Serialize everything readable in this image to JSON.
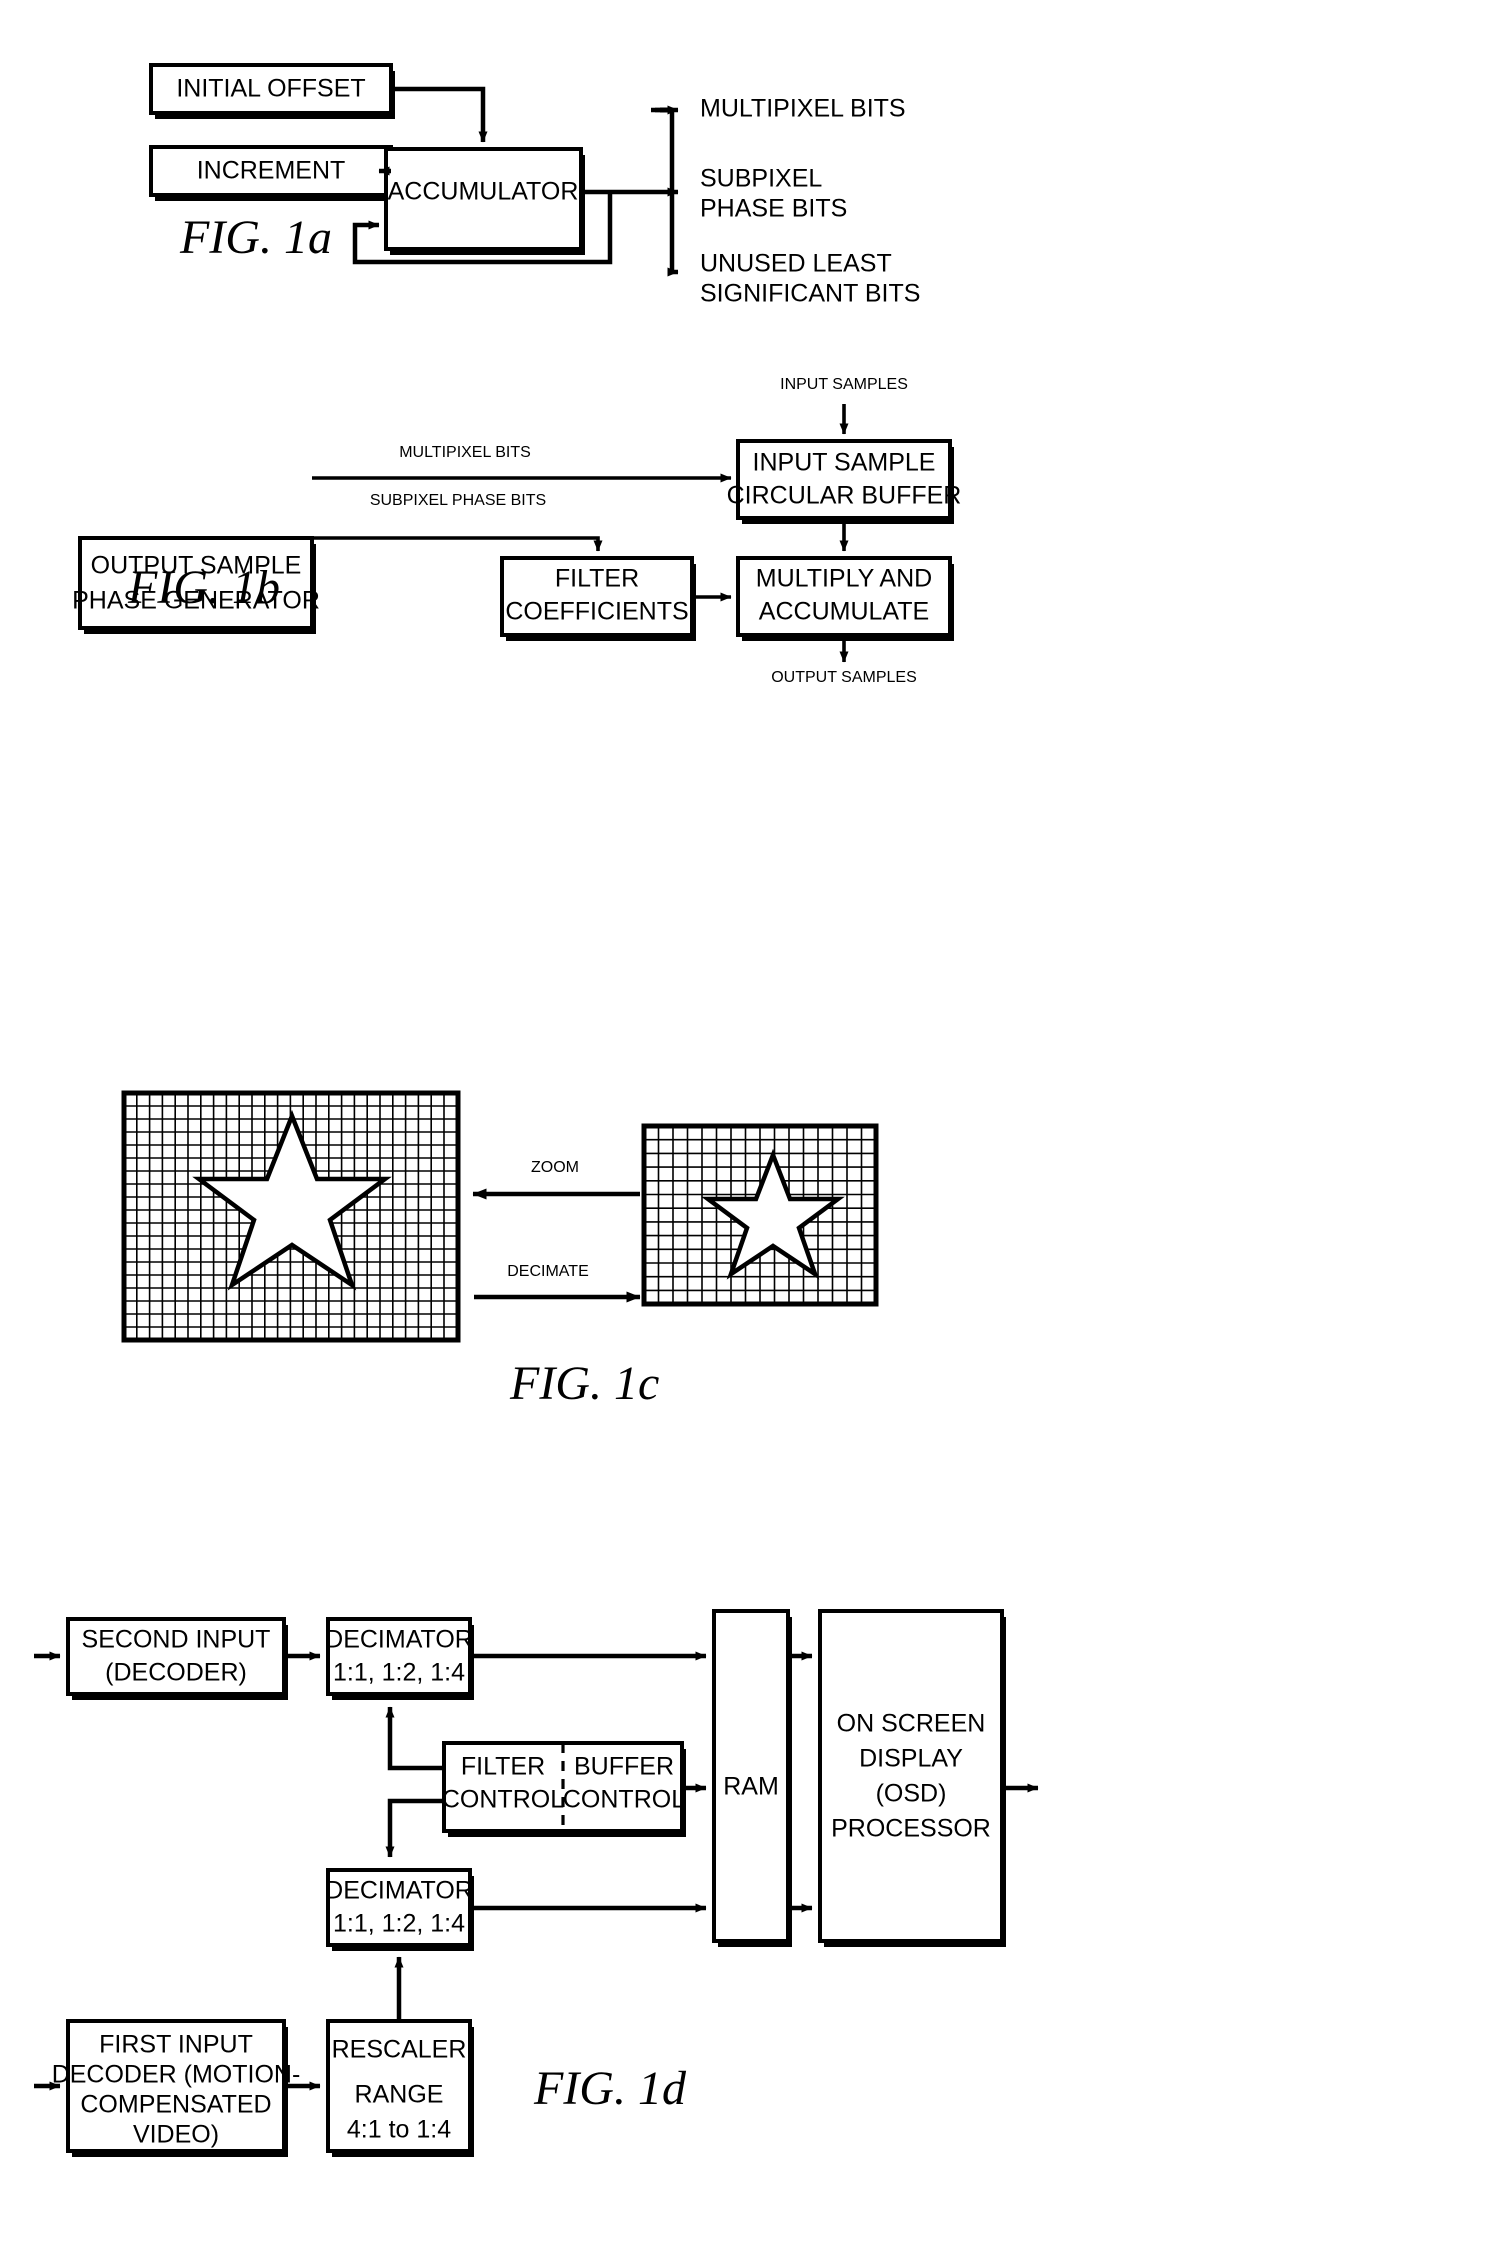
{
  "document": {
    "type": "patent-figure-sheet",
    "figures": [
      "FIG. 1a",
      "FIG. 1b",
      "FIG. 1c",
      "FIG. 1d"
    ]
  },
  "fig1a": {
    "caption": "FIG. 1a",
    "boxes": {
      "initial_offset": "INITIAL OFFSET",
      "increment": "INCREMENT",
      "accumulator": "ACCUMULATOR"
    },
    "outputs": {
      "multipixel": "MULTIPIXEL BITS",
      "subpixel_line1": "SUBPIXEL",
      "subpixel_line2": "PHASE BITS",
      "unused_line1": "UNUSED LEAST",
      "unused_line2": "SIGNIFICANT BITS"
    }
  },
  "fig1b": {
    "caption": "FIG. 1b",
    "boxes": {
      "phase_generator_line1": "OUTPUT SAMPLE",
      "phase_generator_line2": "PHASE GENERATOR",
      "circular_buffer_line1": "INPUT SAMPLE",
      "circular_buffer_line2": "CIRCULAR BUFFER",
      "filter_coeffs_line1": "FILTER",
      "filter_coeffs_line2": "COEFFICIENTS",
      "mac_line1": "MULTIPLY AND",
      "mac_line2": "ACCUMULATE"
    },
    "signals": {
      "multipixel_bits": "MULTIPIXEL BITS",
      "subpixel_phase_bits": "SUBPIXEL PHASE BITS",
      "input_samples": "INPUT SAMPLES",
      "output_samples": "OUTPUT SAMPLES"
    }
  },
  "fig1c": {
    "caption": "FIG. 1c",
    "arrows": {
      "zoom": "ZOOM",
      "decimate": "DECIMATE"
    },
    "left_grid": {
      "cols": 26,
      "rows": 19
    },
    "right_grid": {
      "cols": 16,
      "rows": 13
    }
  },
  "fig1d": {
    "caption": "FIG. 1d",
    "boxes": {
      "second_input_line1": "SECOND INPUT",
      "second_input_line2": "(DECODER)",
      "decimator_top_line1": "DECIMATOR",
      "decimator_top_line2": "1:1, 1:2, 1:4",
      "decimator_bottom_line1": "DECIMATOR",
      "decimator_bottom_line2": "1:1, 1:2, 1:4",
      "filter_control_line1": "FILTER",
      "filter_control_line2": "CONTROL",
      "buffer_control_line1": "BUFFER",
      "buffer_control_line2": "CONTROL",
      "ram": "RAM",
      "osd_line1": "ON SCREEN",
      "osd_line2": "DISPLAY",
      "osd_line3": "(OSD)",
      "osd_line4": "PROCESSOR",
      "first_input_line1": "FIRST INPUT",
      "first_input_line2": "DECODER (MOTION-",
      "first_input_line3": "COMPENSATED",
      "first_input_line4": "VIDEO)",
      "rescaler_line1": "RESCALER",
      "rescaler_line2": "RANGE",
      "rescaler_line3": "4:1 to 1:4"
    }
  },
  "colors": {
    "ink": "#000000",
    "paper": "#ffffff"
  }
}
